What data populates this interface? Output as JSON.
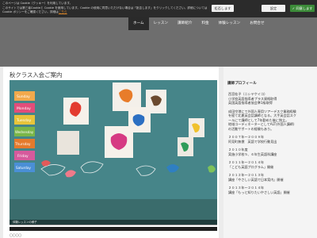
{
  "cookie_bar": {
    "line1": "このページは Cookie（クッキー）を利用しています。",
    "line2": "このサイトでは第三者Cookieと Cookie を使用しています。Cookie の使用に同意いただけない場合は「拒否します」をクリックしてください。詳細については",
    "line3": "Cookie ポリシーをご確認ください。詳細は",
    "link": "こちら",
    "reject_label": "拒否します",
    "settings_label": "設定",
    "accept_label": "同意します",
    "accept_check": "✓"
  },
  "nav": {
    "items": [
      {
        "label": "ホーム",
        "active": true
      },
      {
        "label": "レッスン",
        "active": false
      },
      {
        "label": "講師紹介",
        "active": false
      },
      {
        "label": "料金",
        "active": false
      },
      {
        "label": "体験レッスン",
        "active": false
      },
      {
        "label": "お問合せ",
        "active": false
      }
    ]
  },
  "main": {
    "title": "秋クラス入会ご案内",
    "photo_caption": "体験レッスンの様子",
    "bottom_text": "〇〇〇〇",
    "board_cards": [
      "Sunday",
      "Monday",
      "Tuesday",
      "Wednesday",
      "Thursday",
      "Friday",
      "Saturday"
    ]
  },
  "sidebar": {
    "title": "講師プロフィール",
    "lines": [
      "西宮桂子（ニシヤケイコ）",
      "小学校英語指導者プラス資格取得",
      "英国英語指導者協会準1級取得",
      "",
      "成田空港にて外国人専用ツアーデスク業務経験",
      "を経て北夏英会話講師となる。大手英会話スク",
      "ールにて講師として7年勤めた後に独立。",
      "地域コーディネーターとしてALT(外国人講師)",
      "の活動サポートの経験もあり。",
      "",
      "２００７年〜２００９年",
      "阿見町無償　英語で学校行動見出",
      "",
      "２０１０年度",
      "実施小学校５、６年生英語科講座",
      "",
      "２０１１年〜２０１４年",
      "「こども英語プログラム」開催",
      "",
      "２０１２年〜２０１３年",
      "講座「やさしい英語で日本案内」開催",
      "",
      "２０１３年〜２０１４年",
      "講座「もっと知りたいやさしい英語」開催"
    ]
  }
}
